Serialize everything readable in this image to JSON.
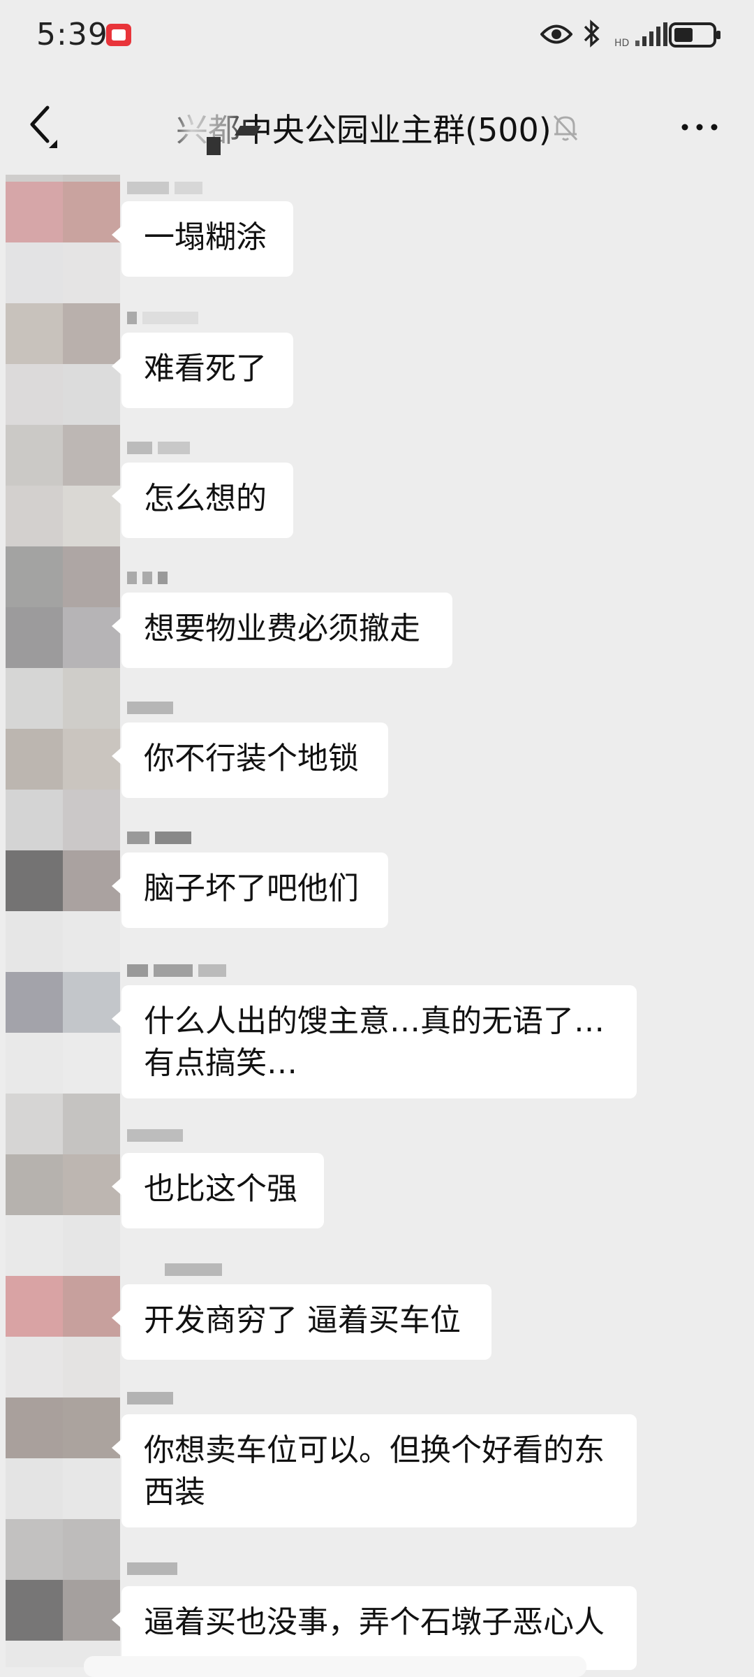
{
  "status_bar": {
    "time": "5:39"
  },
  "header": {
    "title": "兴都中央公园业主群(500)"
  },
  "messages": [
    {
      "text": "一塌糊涂"
    },
    {
      "text": "难看死了"
    },
    {
      "text": "怎么想的"
    },
    {
      "text": "想要物业费必须撤走"
    },
    {
      "text": "你不行装个地锁"
    },
    {
      "text": "脑子坏了吧他们"
    },
    {
      "text": "什么人出的馊主意…真的无语了…\n有点搞笑…"
    },
    {
      "text": "也比这个强"
    },
    {
      "text": "开发商穷了 逼着买车位"
    },
    {
      "text": "你想卖车位可以。但换个好看的东\n西装"
    },
    {
      "text": "逼着买也没事，弄个石墩子恶心人"
    }
  ]
}
